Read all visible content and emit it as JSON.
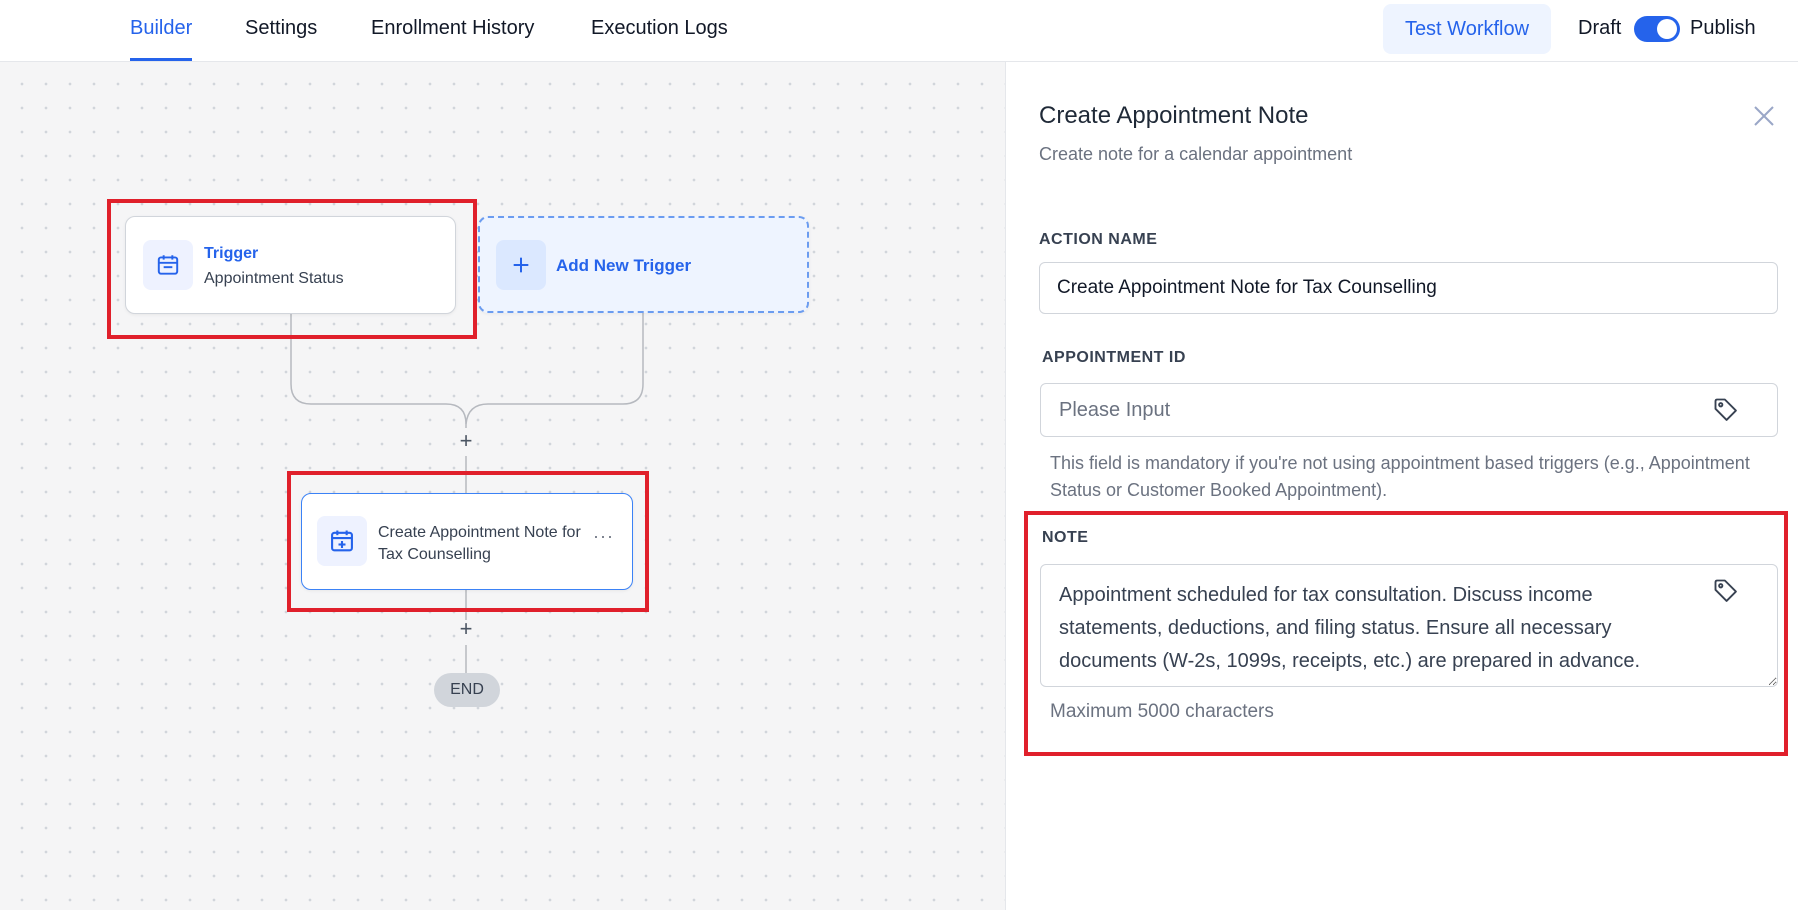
{
  "tabs": [
    {
      "label": "Builder",
      "active": true
    },
    {
      "label": "Settings",
      "active": false
    },
    {
      "label": "Enrollment History",
      "active": false
    },
    {
      "label": "Execution Logs",
      "active": false
    }
  ],
  "header": {
    "test_button": "Test Workflow",
    "draft_label": "Draft",
    "publish_label": "Publish",
    "publish_toggle_on": true
  },
  "canvas": {
    "trigger_node": {
      "title": "Trigger",
      "subtitle": "Appointment Status",
      "icon": "calendar-icon"
    },
    "add_trigger_node": {
      "label": "Add New Trigger",
      "icon": "plus-icon"
    },
    "action_node": {
      "label": "Create Appointment Note for Tax Counselling",
      "icon": "calendar-plus-icon",
      "menu": "···"
    },
    "add_step_symbol": "+",
    "end_label": "END"
  },
  "panel": {
    "title": "Create Appointment Note",
    "description": "Create note for a calendar appointment",
    "action_name": {
      "label": "ACTION NAME",
      "value": "Create Appointment Note for Tax Counselling"
    },
    "appointment_id": {
      "label": "APPOINTMENT ID",
      "placeholder": "Please Input",
      "help": "This field is mandatory if you're not using appointment based triggers (e.g., Appointment Status or Customer Booked Appointment)."
    },
    "note": {
      "label": "NOTE",
      "value": "Appointment scheduled for tax consultation. Discuss income statements, deductions, and filing status. Ensure all necessary documents (W-2s, 1099s, receipts, etc.) are prepared in advance.",
      "hint": "Maximum 5000 characters"
    }
  },
  "colors": {
    "accent": "#2563eb",
    "highlight": "#e0202b",
    "canvas_bg": "#f5f5f6"
  }
}
